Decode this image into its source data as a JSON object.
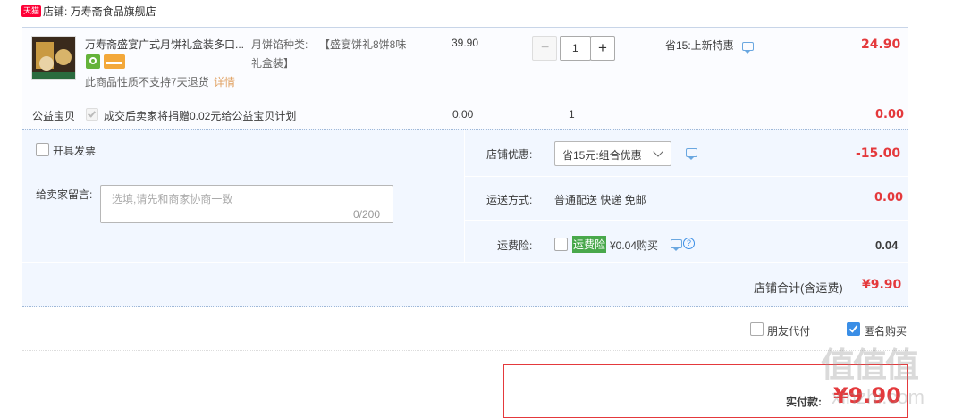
{
  "shop": {
    "badge": "天猫",
    "label": "店铺: 万寿斋食品旗舰店"
  },
  "item": {
    "title": "万寿斋盛宴广式月饼礼盒装多口...",
    "spec_label": "月饼馅种类:",
    "spec_value_1": "【盛宴饼礼8饼8味",
    "spec_value_2": "礼盒装】",
    "unit_price": "39.90",
    "quantity": "1",
    "promo": "省15:上新特惠",
    "subtotal": "24.90",
    "no_return": "此商品性质不支持7天退货",
    "details_link": "详情",
    "minus": "−",
    "plus": "+"
  },
  "charity": {
    "label": "公益宝贝",
    "text": "成交后卖家将捐赠0.02元给公益宝贝计划",
    "price": "0.00",
    "qty": "1",
    "total": "0.00"
  },
  "invoice": {
    "label": "开具发票"
  },
  "message": {
    "label": "给卖家留言:",
    "placeholder": "选填,请先和商家协商一致",
    "counter": "0/200"
  },
  "shop_discount": {
    "label": "店铺优惠:",
    "selected": "省15元:组合优惠",
    "amount": "-15.00"
  },
  "shipping": {
    "label": "运送方式:",
    "value": "普通配送 快递 免邮",
    "amount": "0.00"
  },
  "insurance": {
    "label": "运费险:",
    "badge": "运费险",
    "text": "¥0.04购买",
    "amount": "0.04",
    "help": "?"
  },
  "shop_total": {
    "label": "店铺合计(含运费)",
    "amount": "¥9.90"
  },
  "options": {
    "friend_pay": "朋友代付",
    "anonymous": "匿名购买"
  },
  "payment": {
    "label": "实付款:",
    "amount": "¥9.90"
  },
  "watermark": {
    "text": "值值值",
    "url": "xinzhi.com"
  },
  "colors": {
    "price_red": "#e4393c",
    "panel_bg": "#f2f7ff",
    "accent_blue": "#3a8ee6",
    "insurance_green": "#49a84b"
  }
}
